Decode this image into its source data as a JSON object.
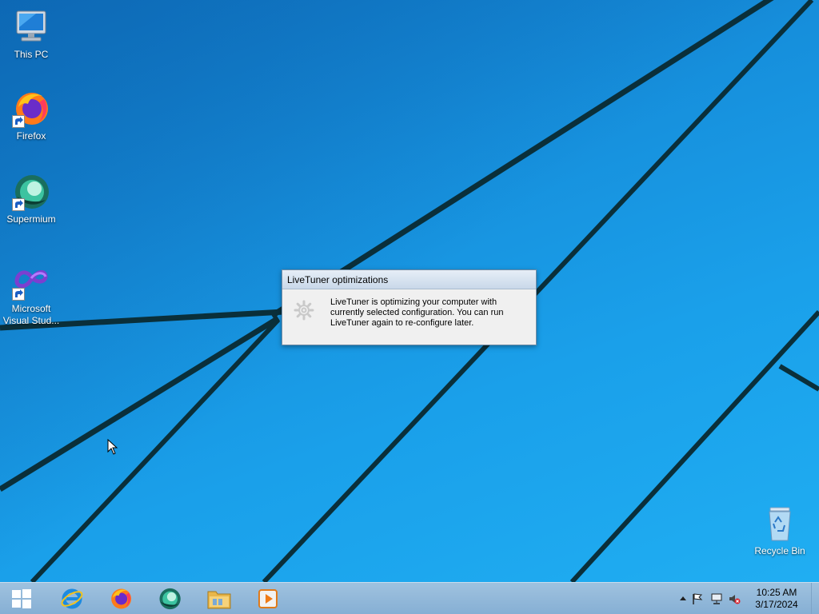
{
  "desktop": {
    "icons": [
      {
        "label": "This PC",
        "icon": "this-pc-icon"
      },
      {
        "label": "Firefox",
        "icon": "firefox-icon"
      },
      {
        "label": "Supermium",
        "icon": "supermium-icon"
      },
      {
        "label": "Microsoft Visual Stud...",
        "icon": "visual-studio-icon"
      },
      {
        "label": "Recycle Bin",
        "icon": "recycle-bin-icon"
      }
    ]
  },
  "dialog": {
    "title": "LiveTuner optimizations",
    "message": "LiveTuner is optimizing your computer with currently selected configuration. You can run LiveTuner again to re-configure later.",
    "icon": "gear-icon"
  },
  "taskbar": {
    "pinned": [
      {
        "name": "internet-explorer",
        "icon": "internet-explorer-icon"
      },
      {
        "name": "firefox",
        "icon": "firefox-icon"
      },
      {
        "name": "supermium",
        "icon": "supermium-icon"
      },
      {
        "name": "file-explorer",
        "icon": "folder-icon"
      },
      {
        "name": "media-player",
        "icon": "media-player-icon"
      }
    ],
    "tray_icons": [
      "chevron-up-icon",
      "flag-icon",
      "network-icon",
      "volume-muted-icon"
    ],
    "clock": {
      "time": "10:25 AM",
      "date": "3/17/2024"
    }
  },
  "colors": {
    "wallpaper": "#1a8fd8",
    "taskbar": "#8fb6d9",
    "dialog_title": "#d6e3f1"
  }
}
